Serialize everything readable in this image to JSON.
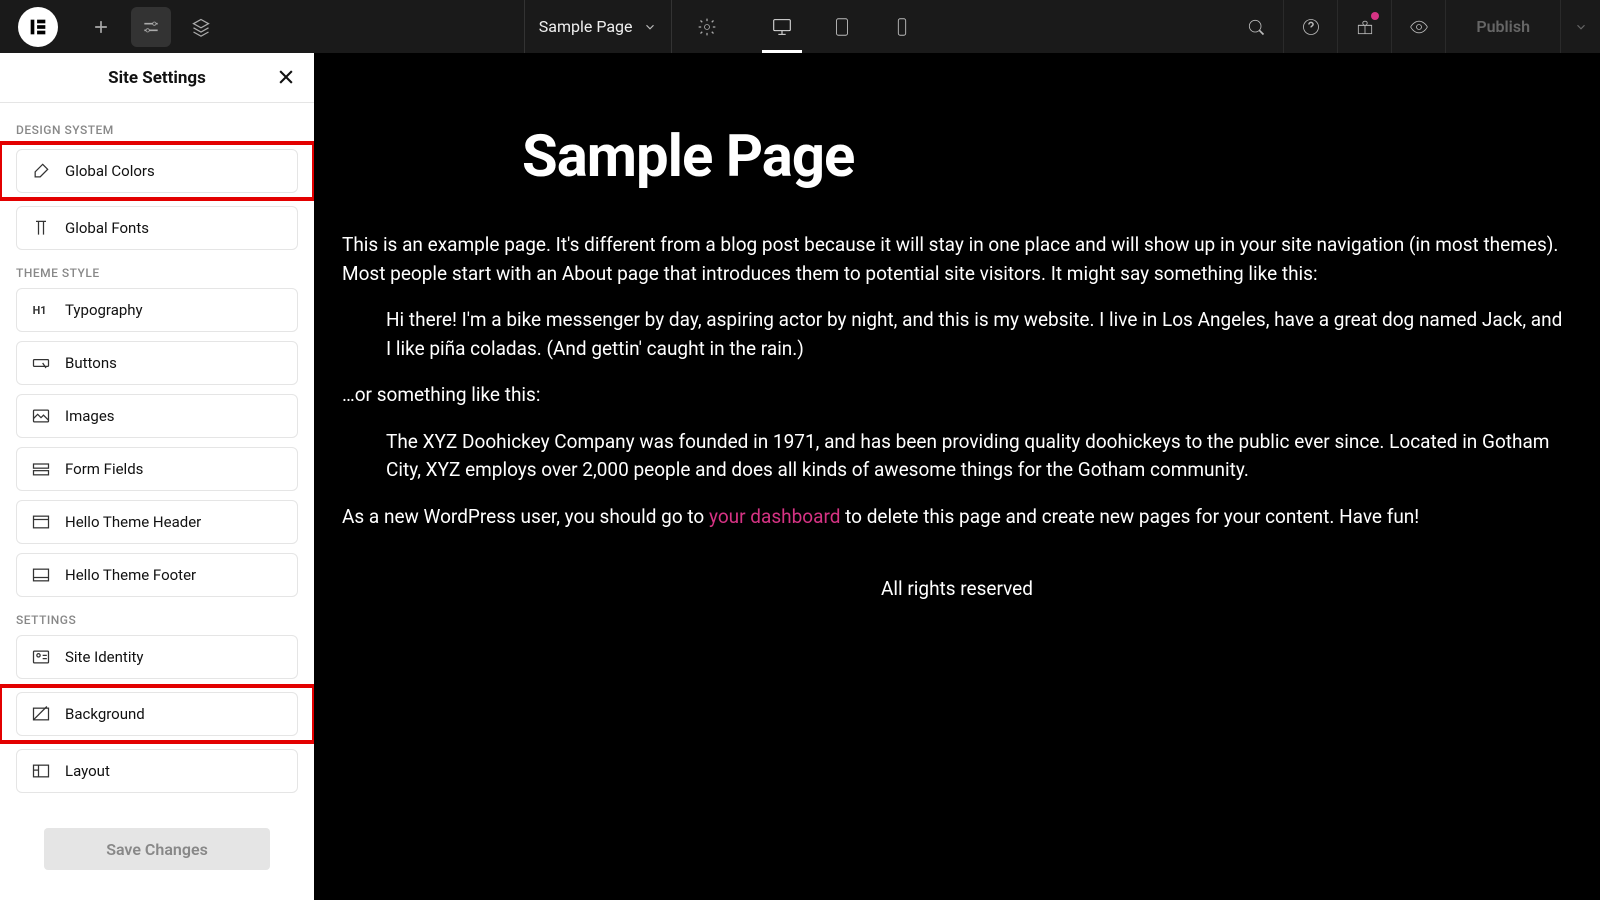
{
  "topbar": {
    "page_name": "Sample Page",
    "publish_label": "Publish"
  },
  "panel": {
    "title": "Site Settings",
    "sections": {
      "design_system": {
        "label": "DESIGN SYSTEM"
      },
      "theme_style": {
        "label": "THEME STYLE"
      },
      "settings": {
        "label": "SETTINGS"
      }
    },
    "items": {
      "global_colors": "Global Colors",
      "global_fonts": "Global Fonts",
      "typography": "Typography",
      "buttons": "Buttons",
      "images": "Images",
      "form_fields": "Form Fields",
      "hello_header": "Hello Theme Header",
      "hello_footer": "Hello Theme Footer",
      "site_identity": "Site Identity",
      "background": "Background",
      "layout": "Layout"
    },
    "save_label": "Save Changes"
  },
  "canvas": {
    "heading": "Sample Page",
    "p1": "This is an example page. It's different from a blog post because it will stay in one place and will show up in your site navigation (in most themes). Most people start with an About page that introduces them to potential site visitors. It might say something like this:",
    "quote1": "Hi there! I'm a bike messenger by day, aspiring actor by night, and this is my website. I live in Los Angeles, have a great dog named Jack, and I like piña coladas. (And gettin' caught in the rain.)",
    "p2": "…or something like this:",
    "quote2": "The XYZ Doohickey Company was founded in 1971, and has been providing quality doohickeys to the public ever since. Located in Gotham City, XYZ employs over 2,000 people and does all kinds of awesome things for the Gotham community.",
    "p3_pre": "As a new WordPress user, you should go to ",
    "p3_link": "your dashboard",
    "p3_post": " to delete this page and create new pages for your content. Have fun!",
    "footer": "All rights reserved"
  }
}
